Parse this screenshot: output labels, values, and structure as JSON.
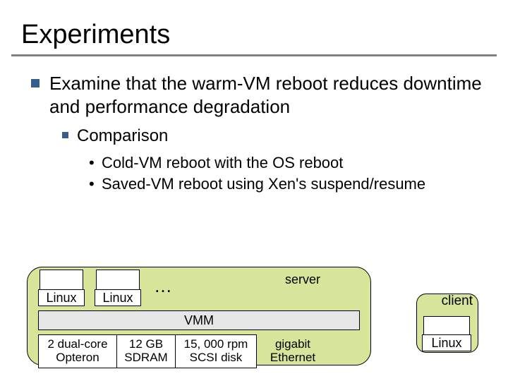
{
  "title": "Experiments",
  "bullets": {
    "main": "Examine that the warm-VM reboot reduces downtime and performance degradation",
    "sub": "Comparison",
    "items": [
      "Cold-VM reboot with the OS reboot",
      "Saved-VM reboot using Xen's suspend/resume"
    ]
  },
  "diagram": {
    "server_label": "server",
    "ellipsis": "…",
    "vm_os": "Linux",
    "vmm": "VMM",
    "hardware": [
      "2 dual-core Opteron",
      "12 GB SDRAM",
      "15, 000 rpm SCSI disk",
      "gigabit Ethernet"
    ],
    "client_label": "client",
    "client_os": "Linux"
  }
}
